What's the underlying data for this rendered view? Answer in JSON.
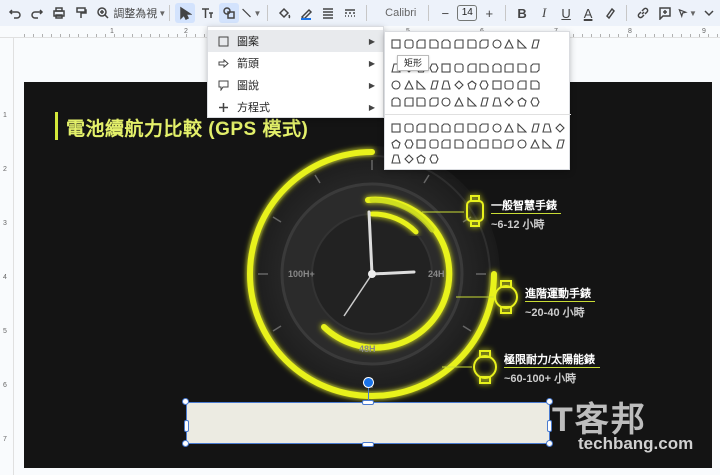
{
  "toolbar": {
    "zoom_label": "調整為視",
    "font_name": "Calibri",
    "font_size": "14"
  },
  "ruler": {
    "h_numbers": [
      "1",
      "2",
      "3",
      "4",
      "5",
      "6",
      "7",
      "8",
      "9"
    ],
    "v_numbers": [
      "1",
      "2",
      "3",
      "4",
      "5",
      "6",
      "7"
    ]
  },
  "menu": {
    "items": [
      {
        "label": "圖案",
        "icon": "square-icon"
      },
      {
        "label": "箭頭",
        "icon": "arrow-icon"
      },
      {
        "label": "圖說",
        "icon": "callout-icon"
      },
      {
        "label": "方程式",
        "icon": "plus-icon"
      }
    ],
    "tooltip": "矩形"
  },
  "slide": {
    "title": "電池續航力比較 (GPS 模式)",
    "dial_labels": {
      "left": "100H+",
      "right": "24H",
      "bottom": "48H"
    },
    "items": [
      {
        "name": "一般智慧手錶",
        "value": "~6-12 小時"
      },
      {
        "name": "進階運動手錶",
        "value": "~20-40 小時"
      },
      {
        "name": "極限耐力/太陽能錶",
        "value": "~60-100+ 小時"
      }
    ],
    "accent_color": "#e8f21c"
  },
  "watermark": {
    "main": "T客邦",
    "sub": "techbang.com"
  }
}
